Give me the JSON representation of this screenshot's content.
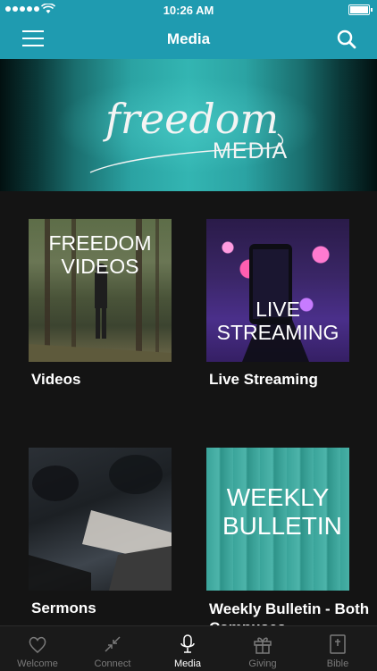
{
  "status_bar": {
    "time": "10:26 AM"
  },
  "nav": {
    "title": "Media"
  },
  "banner": {
    "script_text": "freedom",
    "caption": "MEDIA"
  },
  "tiles": [
    {
      "thumb_text": "FREEDOM VIDEOS",
      "label": "Videos"
    },
    {
      "thumb_text": "LIVE STREAMING",
      "label": "Live Streaming"
    },
    {
      "thumb_text": "",
      "label": "Sermons"
    },
    {
      "thumb_text": "WEEKLY BULLETIN",
      "label": "Weekly Bulletin - Both Campuses"
    }
  ],
  "tabs": [
    {
      "label": "Welcome",
      "icon": "heart-icon"
    },
    {
      "label": "Connect",
      "icon": "connect-icon"
    },
    {
      "label": "Media",
      "icon": "microphone-icon",
      "active": true
    },
    {
      "label": "Giving",
      "icon": "gift-icon"
    },
    {
      "label": "Bible",
      "icon": "bible-icon"
    }
  ],
  "colors": {
    "accent": "#1f9bb0",
    "background": "#141414",
    "tab_inactive": "#7a7a7a"
  }
}
